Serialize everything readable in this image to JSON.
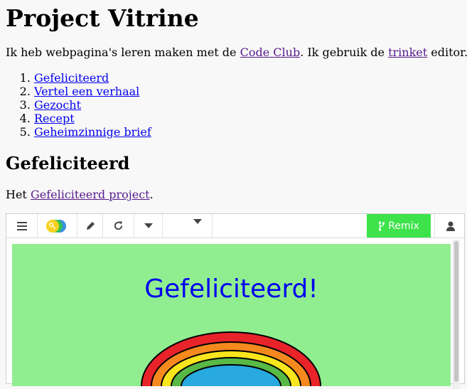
{
  "page": {
    "title": "Project Vitrine",
    "intro": {
      "prefix": "Ik heb webpagina's leren maken met de ",
      "codeclub_link": "Code Club",
      "middle": ". Ik gebruik de ",
      "trinket_link": "trinket",
      "suffix": " editor."
    },
    "projects": [
      "Gefeliciteerd",
      "Vertel een verhaal",
      "Gezocht",
      "Recept",
      "Geheimzinnige brief"
    ]
  },
  "section": {
    "heading": "Gefeliciteerd",
    "text_prefix": "Het ",
    "project_link": "Gefeliciteerd project",
    "text_suffix": "."
  },
  "trinket": {
    "remix_label": "Remix",
    "output_title": "Gefeliciteerd!",
    "colors": {
      "output_bg": "#90ee90",
      "remix_bg": "#3ee34b",
      "title_color": "#0000ee"
    },
    "icons": [
      "menu-icon",
      "trinket-logo-icon",
      "pencil-icon",
      "reload-icon",
      "caret-down-icon",
      "caret-down-icon",
      "branch-icon",
      "user-icon"
    ]
  }
}
